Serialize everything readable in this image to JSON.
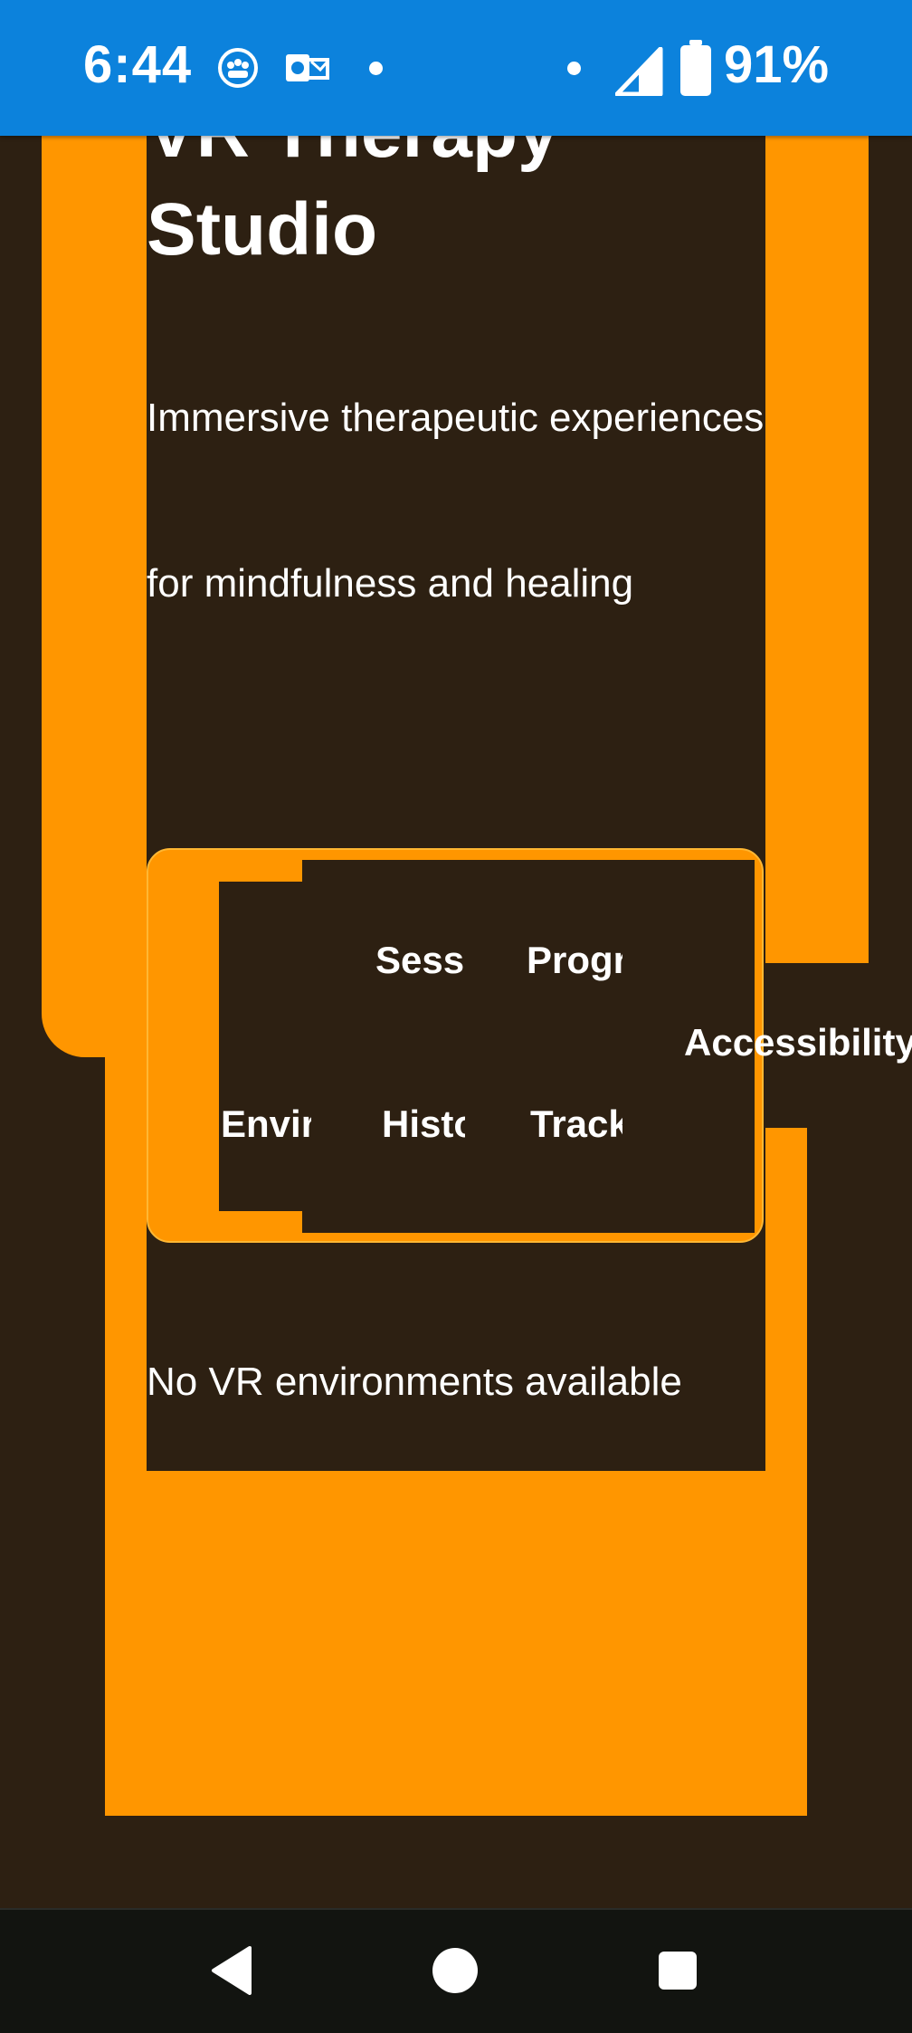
{
  "status_bar": {
    "time": "6:44",
    "battery": "91%"
  },
  "page": {
    "title_line1": "VR Therapy",
    "title_line2": "Studio",
    "description": "Immersive therapeutic experiences for mindfulness and healing",
    "empty_state": "No VR environments available"
  },
  "tabs": {
    "environments": "Envir",
    "session_history_1": "Sess",
    "session_history_2": "Histo",
    "progress_tracking_1": "Progr",
    "progress_tracking_2": "Track",
    "accessibility": "Accessibility"
  },
  "colors": {
    "background": "#2d2012",
    "accent": "#ff9600",
    "status_bar": "#0c82dc"
  }
}
